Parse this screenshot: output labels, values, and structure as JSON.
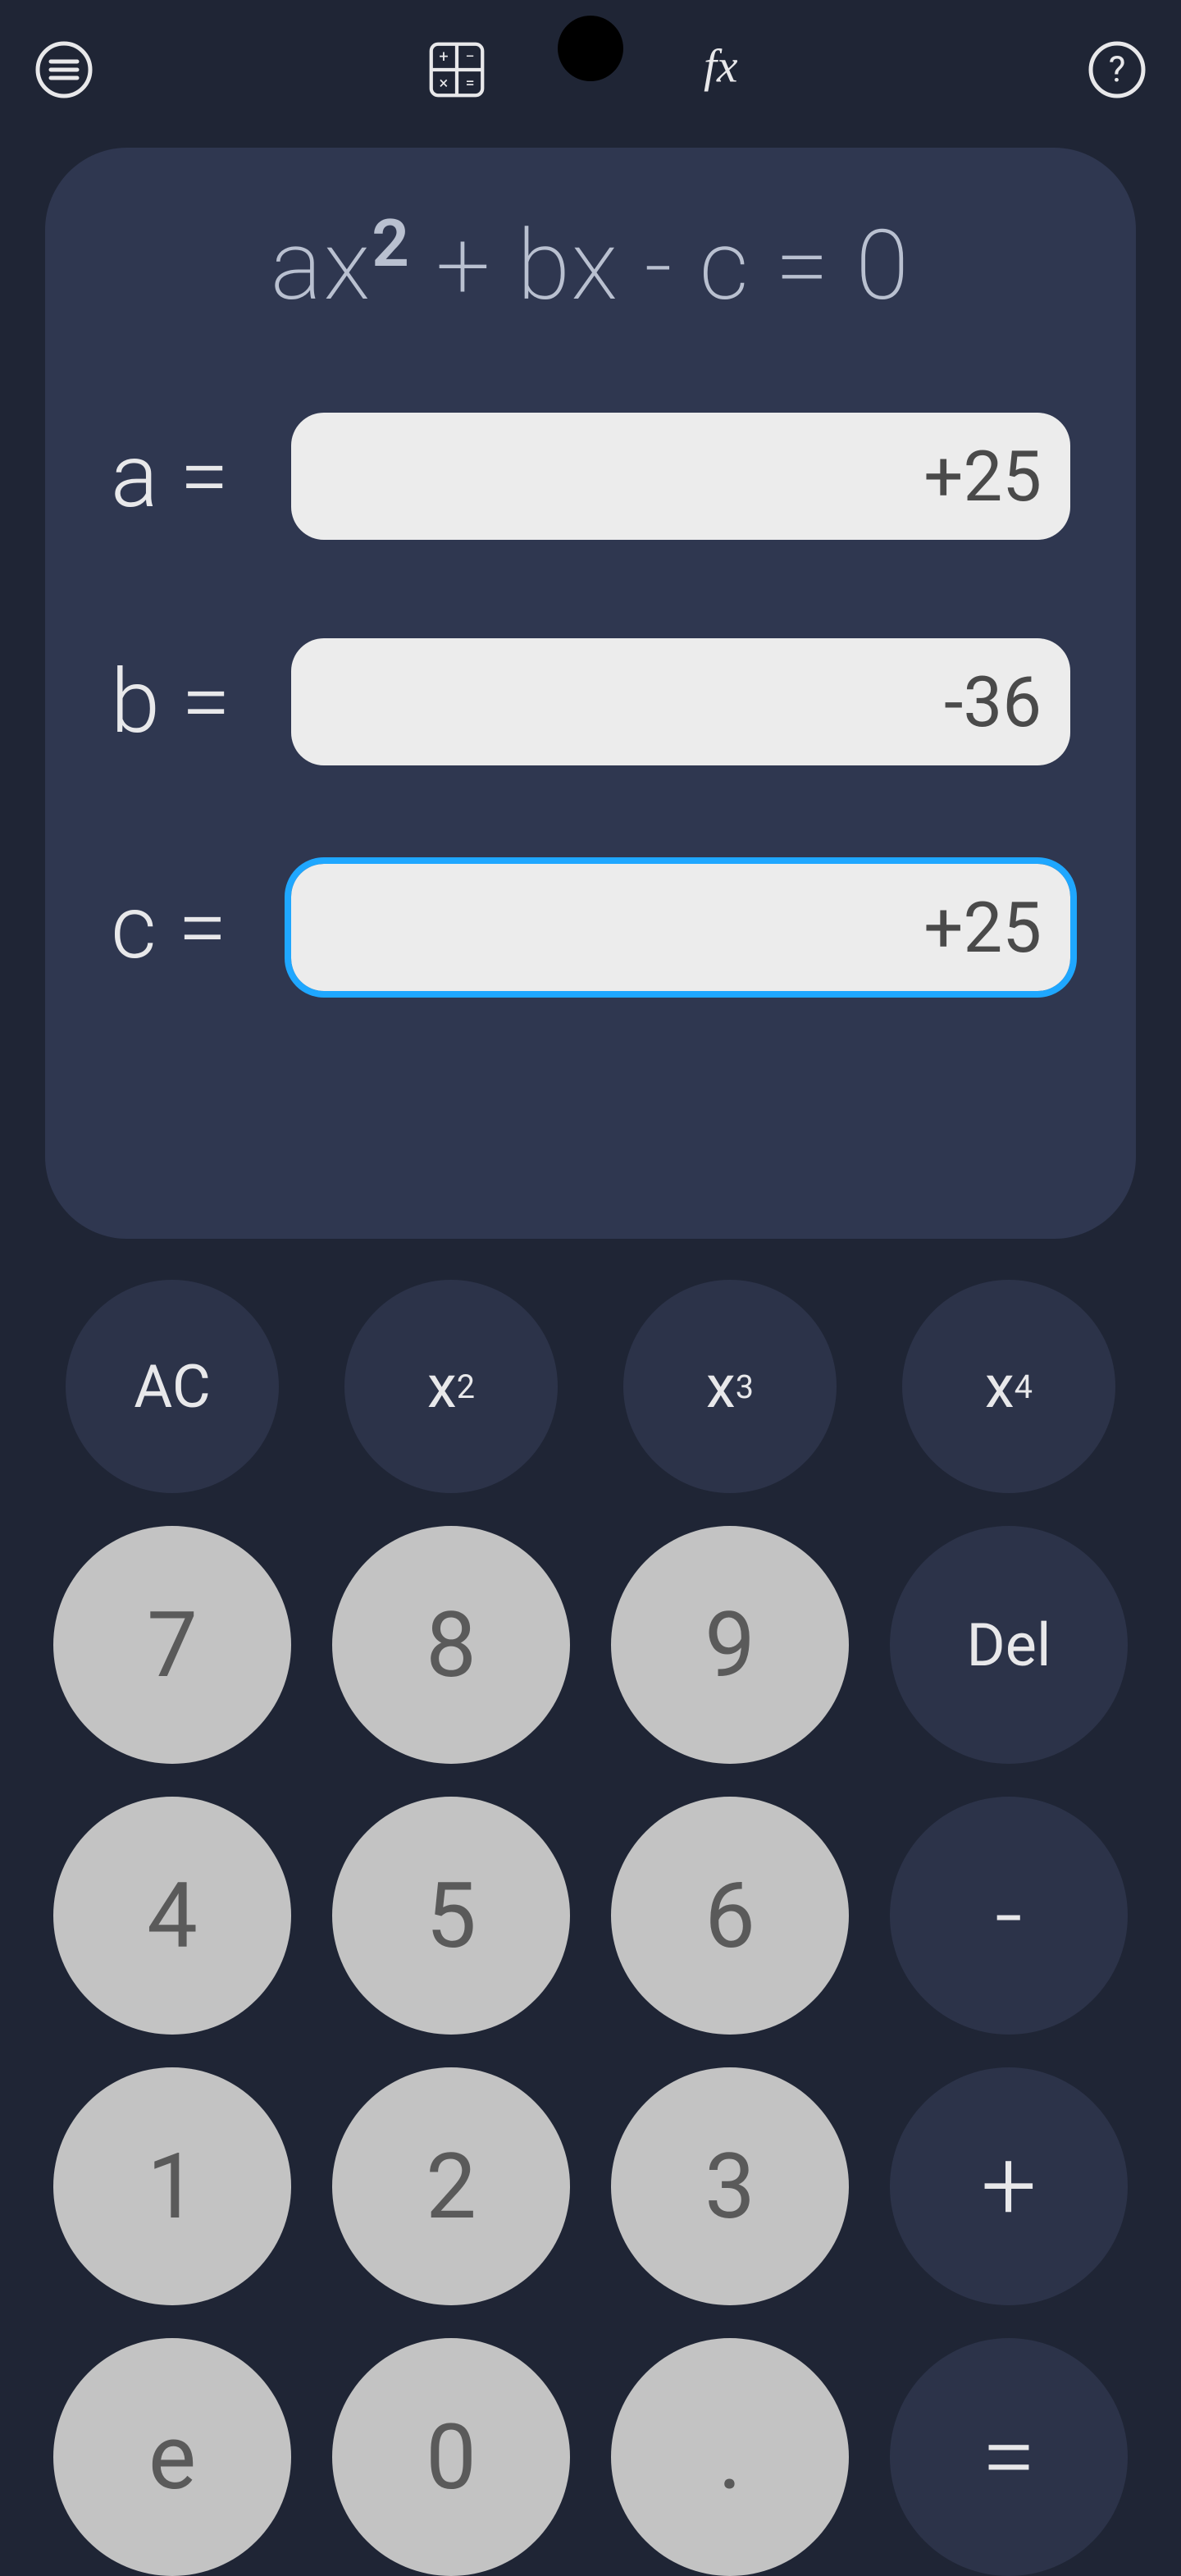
{
  "topbar": {
    "menu_icon": "menu-icon",
    "calc_icon": "calculator-grid-icon",
    "fx_icon": "fx-icon",
    "help_icon": "help-icon"
  },
  "panel": {
    "equation_html": "ax² + bx - c = 0",
    "coefficients": [
      {
        "label": "a =",
        "value": "+25",
        "focused": false
      },
      {
        "label": "b =",
        "value": "-36",
        "focused": false
      },
      {
        "label": "c =",
        "value": "+25",
        "focused": true
      }
    ]
  },
  "keypad": {
    "rows": [
      [
        {
          "label": "AC",
          "kind": "dark",
          "name": "key-ac"
        },
        {
          "label_html": "x<sup>2</sup>",
          "kind": "dark",
          "name": "key-x2"
        },
        {
          "label_html": "x<sup>3</sup>",
          "kind": "dark",
          "name": "key-x3"
        },
        {
          "label_html": "x<sup>4</sup>",
          "kind": "dark",
          "name": "key-x4"
        }
      ],
      [
        {
          "label": "7",
          "kind": "light",
          "name": "key-7"
        },
        {
          "label": "8",
          "kind": "light",
          "name": "key-8"
        },
        {
          "label": "9",
          "kind": "light",
          "name": "key-9"
        },
        {
          "label": "Del",
          "kind": "dark",
          "name": "key-del",
          "fs": "72"
        }
      ],
      [
        {
          "label": "4",
          "kind": "light",
          "name": "key-4"
        },
        {
          "label": "5",
          "kind": "light",
          "name": "key-5"
        },
        {
          "label": "6",
          "kind": "light",
          "name": "key-6"
        },
        {
          "label": "-",
          "kind": "dark",
          "name": "key-minus",
          "op": true
        }
      ],
      [
        {
          "label": "1",
          "kind": "light",
          "name": "key-1"
        },
        {
          "label": "2",
          "kind": "light",
          "name": "key-2"
        },
        {
          "label": "3",
          "kind": "light",
          "name": "key-3"
        },
        {
          "label": "+",
          "kind": "dark",
          "name": "key-plus",
          "op": true
        }
      ],
      [
        {
          "label": "e",
          "kind": "light",
          "name": "key-e"
        },
        {
          "label": "0",
          "kind": "light",
          "name": "key-0"
        },
        {
          "label": ".",
          "kind": "light",
          "name": "key-dot"
        },
        {
          "label": "=",
          "kind": "dark",
          "name": "key-equals",
          "op": true
        }
      ]
    ]
  }
}
